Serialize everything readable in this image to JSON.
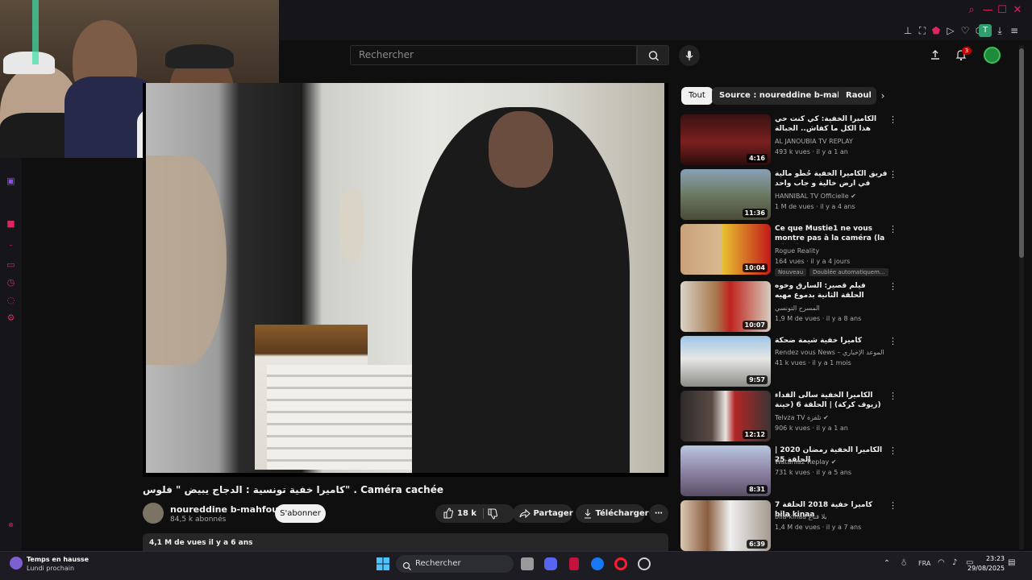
{
  "browser": {
    "window_controls": {
      "search": "⌕",
      "minimize": "—",
      "maximize": "☐",
      "close": "✕"
    },
    "profile_initial": "T",
    "accent_color": "#e0245e"
  },
  "masthead": {
    "search_placeholder": "Rechercher",
    "notification_count": "3"
  },
  "video": {
    "title": "كاميرا خفية تونسية : الدجاج يبيض \" فلوس\" . Caméra cachée",
    "channel_name": "noureddine b-mahfoudh",
    "subscribers": "84,5 k abonnés",
    "subscribe_label": "S'abonner",
    "likes": "18 k",
    "share_label": "Partager",
    "download_label": "Télécharger",
    "views_and_date": "4,1 M de vues  il y a 6 ans"
  },
  "chips": [
    {
      "label": "Tout",
      "active": true
    },
    {
      "label": "Source : noureddine b-mahfoudh",
      "active": false
    },
    {
      "label": "Raoul",
      "active": false
    }
  ],
  "related": [
    {
      "title": "الكاميرا الخفية: كي كنت حي هذا الكل ما كفاش.. الجبالة معين بريي؟",
      "channel": "AL JANOUBIA TV REPLAY",
      "meta": "493 k vues · il y a 1 an",
      "duration": "4:16",
      "verified": false
    },
    {
      "title": "فريق الكاميرا الخفية حُطّو مالية في ارض خالية و جاب واحد باش يحفر عليها يلقى ...",
      "channel": "HANNIBAL TV Officielle",
      "meta": "1 M de vues · il y a 4 ans",
      "duration": "11:36",
      "verified": true
    },
    {
      "title": "Ce que Mustie1 ne vous montre pas à la caméra (la vérité vous...",
      "channel": "Rogue Reality",
      "meta": "164 vues · il y a 4 jours",
      "duration": "10:04",
      "verified": false,
      "badges": [
        "Nouveau",
        "Doublée automatiquem..."
      ]
    },
    {
      "title": "فيلم قصير: السارق وخوه الحلقة الثانية بدموع مهيه",
      "channel": "المسرح التونسي",
      "meta": "1,9 M de vues · il y a 8 ans",
      "duration": "10:07",
      "verified": false
    },
    {
      "title": "كاميرا خفية شيمة ضحكة",
      "channel": "Rendez vous News – الموعد الإخباري",
      "meta": "41 k vues · il y a 1 mois",
      "duration": "9:57",
      "verified": false
    },
    {
      "title": "الكاميرا الخفية سالى الفداء (زيوف كركة) | الحلقة 6 (حينة الحلقة دجلة التونسية)",
      "channel": "Telvza TV تلفزة",
      "meta": "906 k vues · il y a 1 an",
      "duration": "12:12",
      "verified": true
    },
    {
      "title": "الكاميرا الخفية رمضان 2020 | الحلقة 25",
      "channel": "Watania2 Replay",
      "meta": "731 k vues · il y a 5 ans",
      "duration": "8:31",
      "verified": true
    },
    {
      "title": "كاميرا خفية 2018 الحلقة 7 bila kinaa",
      "channel": "bila-kinaa بلا قناع",
      "meta": "1,4 M de vues · il y a 7 ans",
      "duration": "6:39",
      "verified": false
    }
  ],
  "taskbar": {
    "weather_title": "Temps en hausse",
    "weather_sub": "Lundi prochain",
    "search_label": "Rechercher",
    "language": "FRA",
    "time": "23:23",
    "date": "29/08/2025"
  }
}
